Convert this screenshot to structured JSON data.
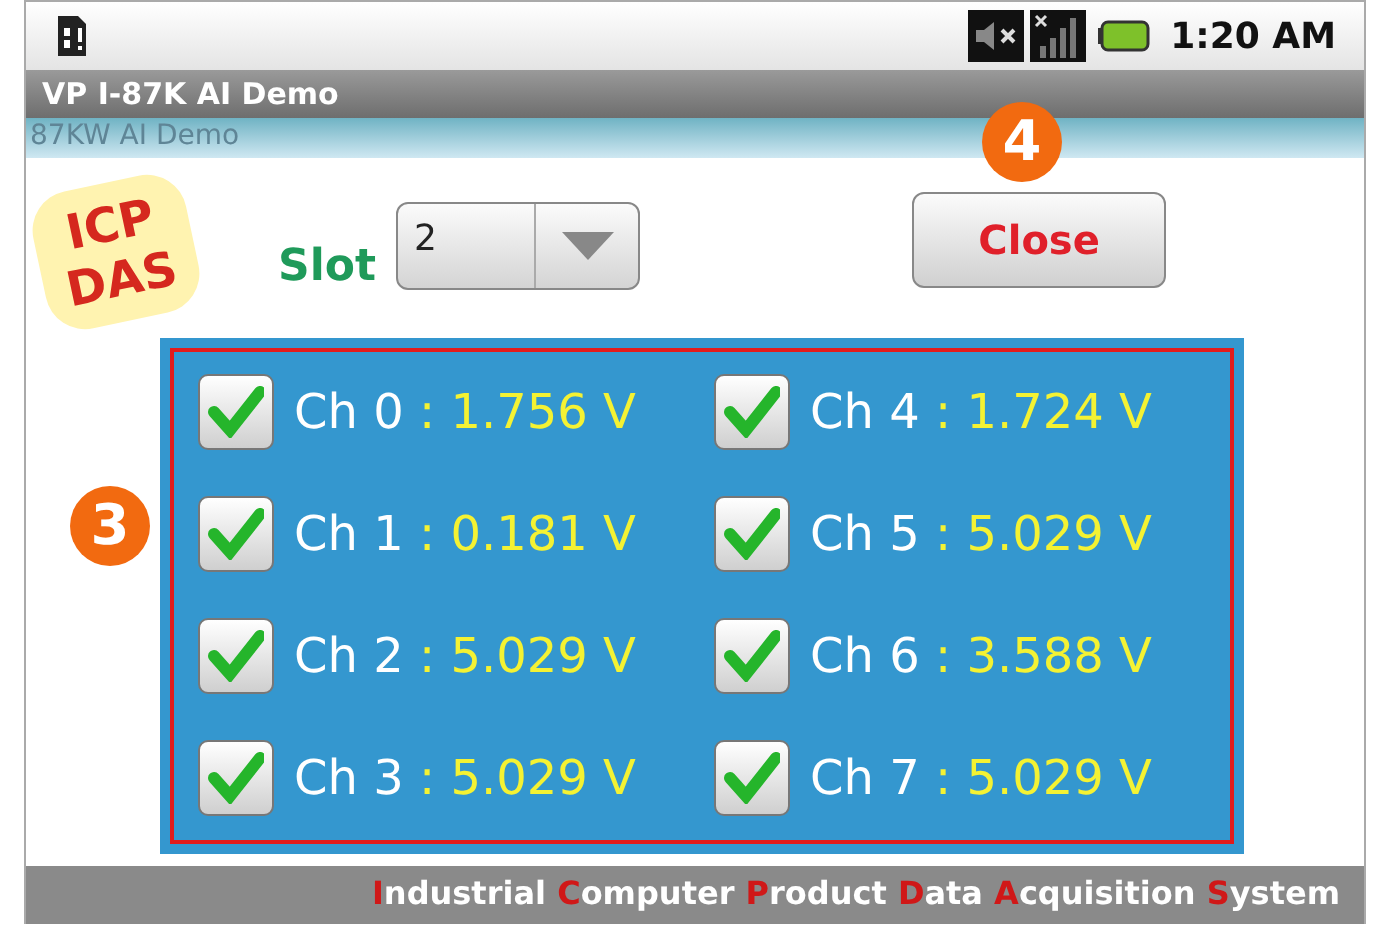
{
  "status_bar": {
    "time": "1:20 AM"
  },
  "window": {
    "title": "VP I-87K AI Demo",
    "ghost_title": "87KW AI Demo"
  },
  "logo": {
    "text": "ICP DAS"
  },
  "slot": {
    "label": "Slot",
    "value": "2"
  },
  "close_button": {
    "label": "Close"
  },
  "callouts": [
    {
      "number": "4"
    },
    {
      "number": "3"
    }
  ],
  "channels": [
    {
      "label": "Ch 0",
      "value": ": 1.756 V",
      "checked": true
    },
    {
      "label": "Ch 1",
      "value": ": 0.181 V",
      "checked": true
    },
    {
      "label": "Ch 2",
      "value": ": 5.029 V",
      "checked": true
    },
    {
      "label": "Ch 3",
      "value": ": 5.029 V",
      "checked": true
    },
    {
      "label": "Ch 4",
      "value": ": 1.724 V",
      "checked": true
    },
    {
      "label": "Ch 5",
      "value": ": 5.029 V",
      "checked": true
    },
    {
      "label": "Ch 6",
      "value": ": 3.588 V",
      "checked": true
    },
    {
      "label": "Ch 7",
      "value": ": 5.029 V",
      "checked": true
    }
  ],
  "footer": {
    "words": [
      {
        "initial": "I",
        "rest": "ndustrial"
      },
      {
        "initial": "C",
        "rest": "omputer"
      },
      {
        "initial": "P",
        "rest": "roduct"
      },
      {
        "initial": "D",
        "rest": "ata"
      },
      {
        "initial": "A",
        "rest": "cquisition"
      },
      {
        "initial": "S",
        "rest": "ystem"
      }
    ]
  }
}
